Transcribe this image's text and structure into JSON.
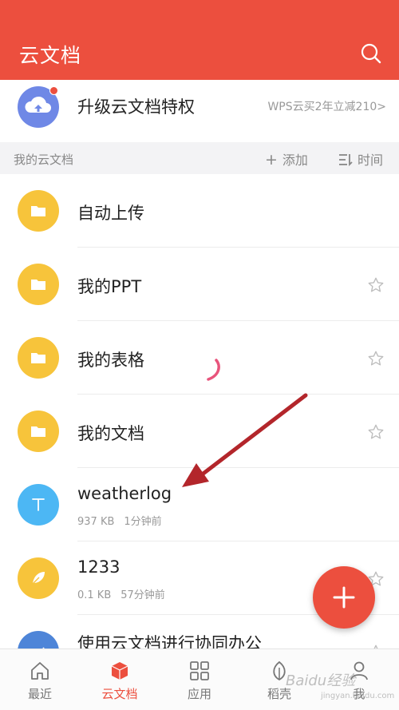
{
  "header": {
    "title": "云文档",
    "search_icon": "search-icon",
    "bg_color": "#ec4f3e"
  },
  "upgrade": {
    "label": "升级云文档特权",
    "promo": "WPS云买2年立减210>",
    "icon": "cloud-upload-icon"
  },
  "section": {
    "title": "我的云文档",
    "add_label": "添加",
    "sort_label": "时间"
  },
  "files": [
    {
      "name": "自动上传",
      "type": "folder",
      "icon": "folder-icon",
      "starred": false,
      "show_star": false
    },
    {
      "name": "我的PPT",
      "type": "folder",
      "icon": "folder-icon",
      "show_star": true
    },
    {
      "name": "我的表格",
      "type": "folder",
      "icon": "folder-icon",
      "show_star": true
    },
    {
      "name": "我的文档",
      "type": "folder",
      "icon": "folder-icon",
      "show_star": true
    },
    {
      "name": "weatherlog",
      "type": "text-file",
      "icon": "text-file-icon",
      "size": "937 KB",
      "time": "1分钟前",
      "show_star": false
    },
    {
      "name": "1233",
      "type": "note",
      "icon": "feather-icon",
      "size": "0.1 KB",
      "time": "57分钟前",
      "show_star": true
    },
    {
      "name": "使用云文档进行协同办公",
      "type": "document",
      "icon": "chart-doc-icon",
      "show_star": true
    }
  ],
  "fab": {
    "icon": "plus-icon"
  },
  "nav": [
    {
      "label": "最近",
      "icon": "home-icon",
      "active": false
    },
    {
      "label": "云文档",
      "icon": "cube-icon",
      "active": true
    },
    {
      "label": "应用",
      "icon": "grid-icon",
      "active": false
    },
    {
      "label": "稻壳",
      "icon": "leaf-icon",
      "active": false
    },
    {
      "label": "我",
      "icon": "person-icon",
      "active": false
    }
  ],
  "watermark": {
    "text": "Baidu经验",
    "sub": "jingyan.baidu.com"
  },
  "colors": {
    "accent": "#ec4f3e",
    "folder": "#f7c43b",
    "text_file": "#4cb7f4",
    "upgrade": "#6f88e6"
  }
}
